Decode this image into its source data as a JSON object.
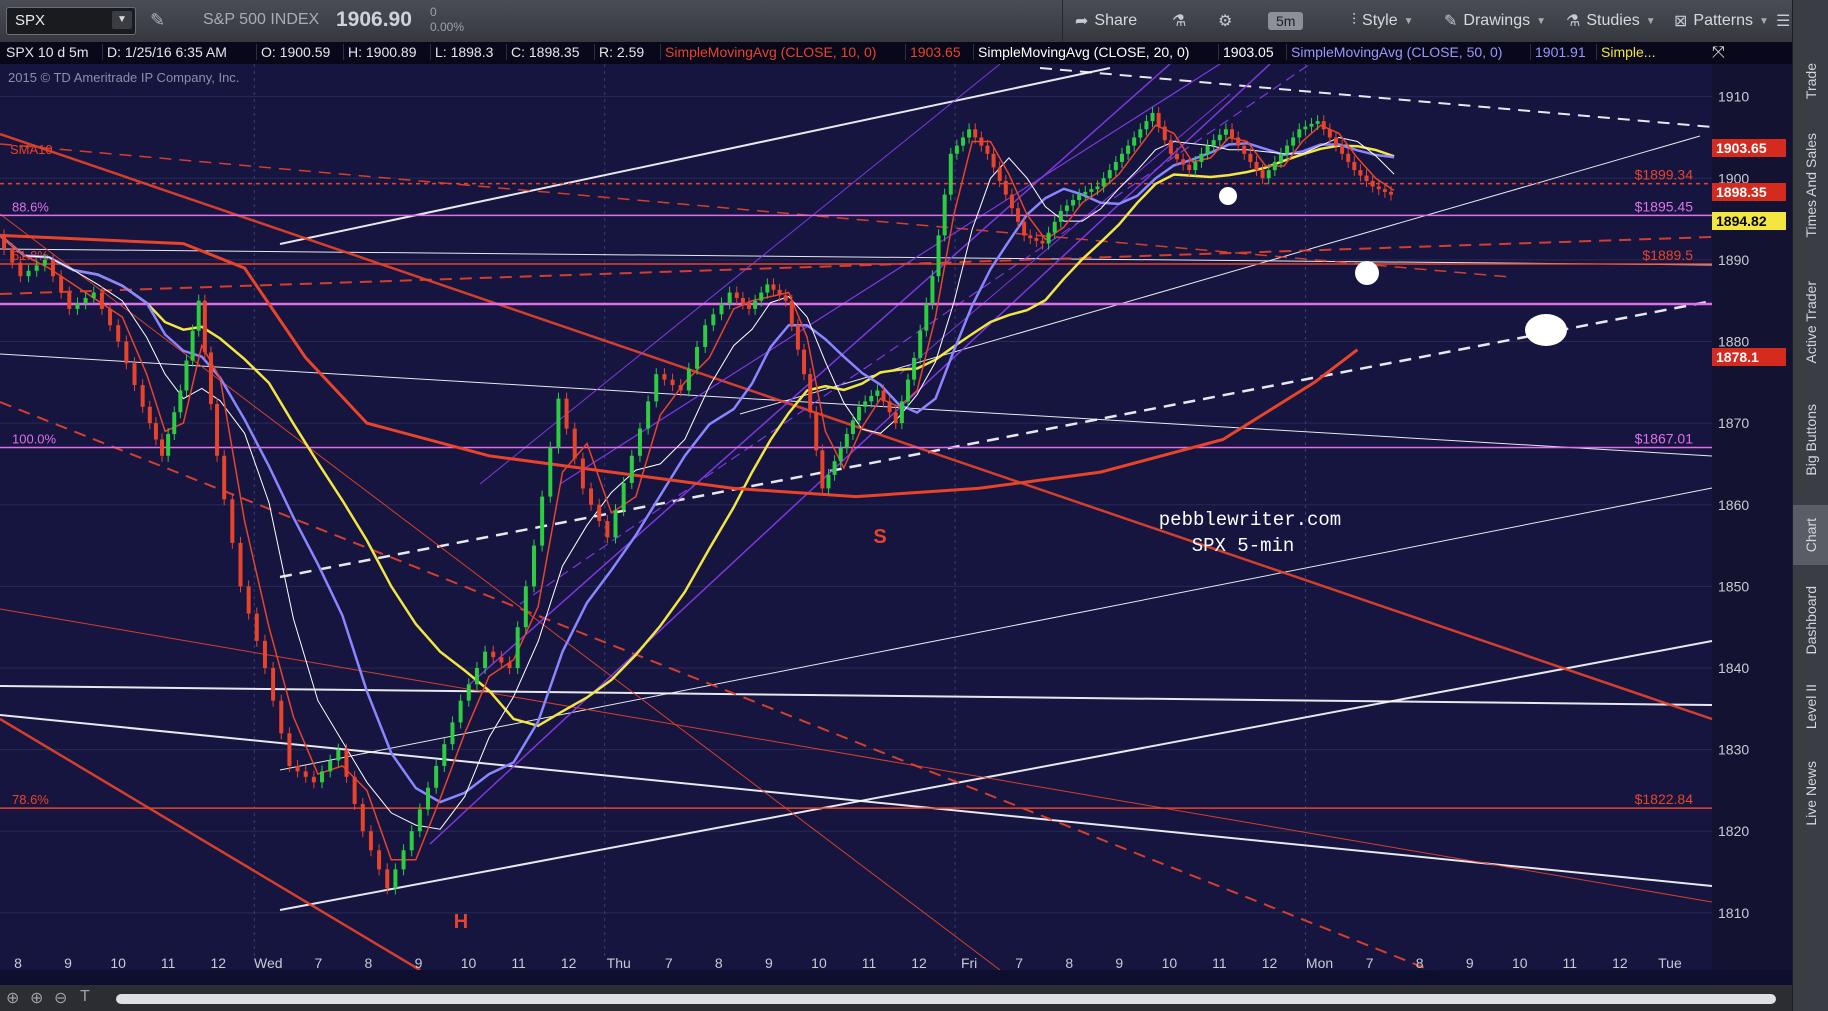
{
  "toolbar": {
    "symbol": "SPX",
    "description": "S&P 500 INDEX",
    "last_price": "1906.90",
    "change": "0",
    "change_pct": "0.00%",
    "share": "Share",
    "timeframe": "5m",
    "style": "Style",
    "drawings": "Drawings",
    "studies": "Studies",
    "patterns": "Patterns"
  },
  "header": {
    "instrument": "SPX 10 d 5m",
    "date": "D: 1/25/16 6:35 AM",
    "open": "O: 1900.59",
    "high": "H: 1900.89",
    "low": "L: 1898.3",
    "close": "C: 1898.35",
    "range": "R: 2.59",
    "sma10_label": "SimpleMovingAvg (CLOSE, 10, 0)",
    "sma10_value": "1903.65",
    "sma20_label": "SimpleMovingAvg (CLOSE, 20, 0)",
    "sma20_value": "1903.05",
    "sma50_label": "SimpleMovingAvg (CLOSE, 50, 0)",
    "sma50_value": "1901.91",
    "more": "Simple..."
  },
  "copyright": "2015 © TD Ameritrade IP Company, Inc.",
  "watermark": {
    "line1": "pebblewriter.com",
    "line2": "SPX 5-min"
  },
  "annotations": {
    "head": "H",
    "shoulder": "S",
    "sma10_tag": "SMA10"
  },
  "fib_levels": [
    {
      "pct": "88.6%",
      "value": 1895.45,
      "label": "$1895.45",
      "color": "#e070e8"
    },
    {
      "pct": "61.8%",
      "value": 1889.5,
      "label": "$1889.5",
      "color": "#e8442a"
    },
    {
      "pct": "100.0%",
      "value": 1867.01,
      "label": "$1867.01",
      "color": "#e070e8"
    },
    {
      "pct": "78.6%",
      "value": 1822.84,
      "label": "$1822.84",
      "color": "#e8442a"
    },
    {
      "pct": "",
      "value": 1899.34,
      "label": "$1899.34",
      "color": "#e8442a"
    }
  ],
  "price_tags": [
    {
      "label": "1903.65",
      "value": 1903.65,
      "bg": "#d52a1e",
      "fg": "#ffffff"
    },
    {
      "label": "1898.35",
      "value": 1898.35,
      "bg": "#d52a1e",
      "fg": "#ffffff"
    },
    {
      "label": "1894.82",
      "value": 1894.82,
      "bg": "#f2e640",
      "fg": "#000000"
    },
    {
      "label": "1878.1",
      "value": 1878.1,
      "bg": "#d52a1e",
      "fg": "#ffffff"
    }
  ],
  "side_tabs": [
    "Trade",
    "Times And Sales",
    "Active Trader",
    "Big Buttons",
    "Chart",
    "Dashboard",
    "Level II",
    "Live News"
  ],
  "colors": {
    "background": "#151540",
    "sma10": "#e8442a",
    "sma20": "#ffffff",
    "sma50": "#8a86ff",
    "sma200": "#f2e640",
    "up_candle": "#2ecc40",
    "down_candle": "#e8442a",
    "channel": "#8a3cf0"
  },
  "chart_data": {
    "type": "line",
    "title": "",
    "xlabel": "",
    "ylabel": "",
    "ylim": [
      1803,
      1914
    ],
    "y_ticks": [
      1810,
      1820,
      1830,
      1840,
      1850,
      1860,
      1870,
      1880,
      1890,
      1900,
      1910
    ],
    "x_ticks": [
      "8",
      "9",
      "10",
      "11",
      "12",
      "Wed",
      "7",
      "8",
      "9",
      "10",
      "11",
      "12",
      "Thu",
      "7",
      "8",
      "9",
      "10",
      "11",
      "12",
      "Fri",
      "7",
      "8",
      "9",
      "10",
      "11",
      "12",
      "Mon",
      "7",
      "8",
      "9",
      "10",
      "11",
      "12",
      "Tue"
    ],
    "grid": true,
    "price_series": {
      "name": "SPX",
      "x": [
        0,
        4,
        8,
        12,
        16,
        20,
        24,
        27,
        30,
        33,
        36,
        40,
        44,
        48,
        52,
        56,
        60,
        64,
        68,
        72,
        76,
        80,
        84,
        88,
        92,
        96,
        100,
        104,
        108,
        112,
        116,
        120,
        123,
        126,
        129,
        132,
        135,
        138,
        141,
        144,
        147,
        150,
        153,
        156,
        159,
        162,
        165,
        168,
        171,
        174,
        177,
        180,
        183,
        186,
        189,
        192,
        195,
        198,
        201,
        204,
        207,
        210,
        213,
        216,
        219,
        222,
        225,
        228
      ],
      "y": [
        1893,
        1888,
        1890,
        1884,
        1886,
        1880,
        1872,
        1866,
        1874,
        1885,
        1866,
        1850,
        1840,
        1828,
        1826,
        1830,
        1820,
        1813,
        1820,
        1828,
        1836,
        1842,
        1840,
        1855,
        1873,
        1862,
        1856,
        1866,
        1876,
        1874,
        1882,
        1886,
        1884,
        1887,
        1885,
        1876,
        1862,
        1867,
        1872,
        1874,
        1870,
        1878,
        1888,
        1903,
        1906,
        1903,
        1898,
        1893,
        1892,
        1896,
        1898,
        1899,
        1902,
        1905,
        1908,
        1903,
        1901,
        1904,
        1906,
        1903,
        1900,
        1903,
        1906,
        1907,
        1904,
        1901,
        1899,
        1898
      ]
    }
  }
}
